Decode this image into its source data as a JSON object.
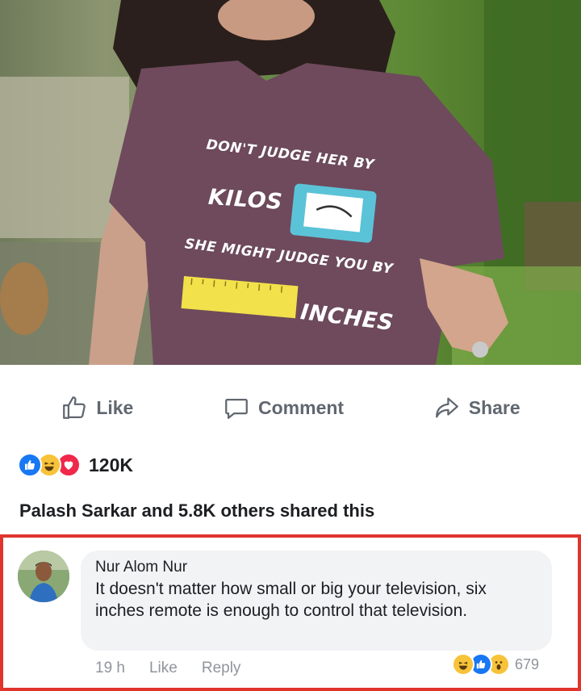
{
  "post": {
    "photo": {
      "shirt_lines": [
        "DON'T JUDGE HER BY",
        "KILOS",
        "SHE MIGHT JUDGE YOU BY",
        "INCHES"
      ]
    },
    "actions": {
      "like_label": "Like",
      "comment_label": "Comment",
      "share_label": "Share"
    },
    "reactions": {
      "types": [
        "like",
        "haha",
        "love"
      ],
      "count": "120K"
    },
    "shared_text": "Palash Sarkar and 5.8K others shared this"
  },
  "comment": {
    "author": "Nur Alom Nur",
    "text": "It doesn't matter how small or big your television, six inches remote is enough to control that television.",
    "time": "19 h",
    "like_label": "Like",
    "reply_label": "Reply",
    "reactions": [
      "haha",
      "like",
      "wow"
    ],
    "reaction_count": "679",
    "highlight_color": "#e0342c"
  },
  "colors": {
    "like_blue": "#1877f2",
    "love_red": "#f0284a",
    "haha_yellow": "#f7c33a",
    "muted_text": "#606770"
  }
}
